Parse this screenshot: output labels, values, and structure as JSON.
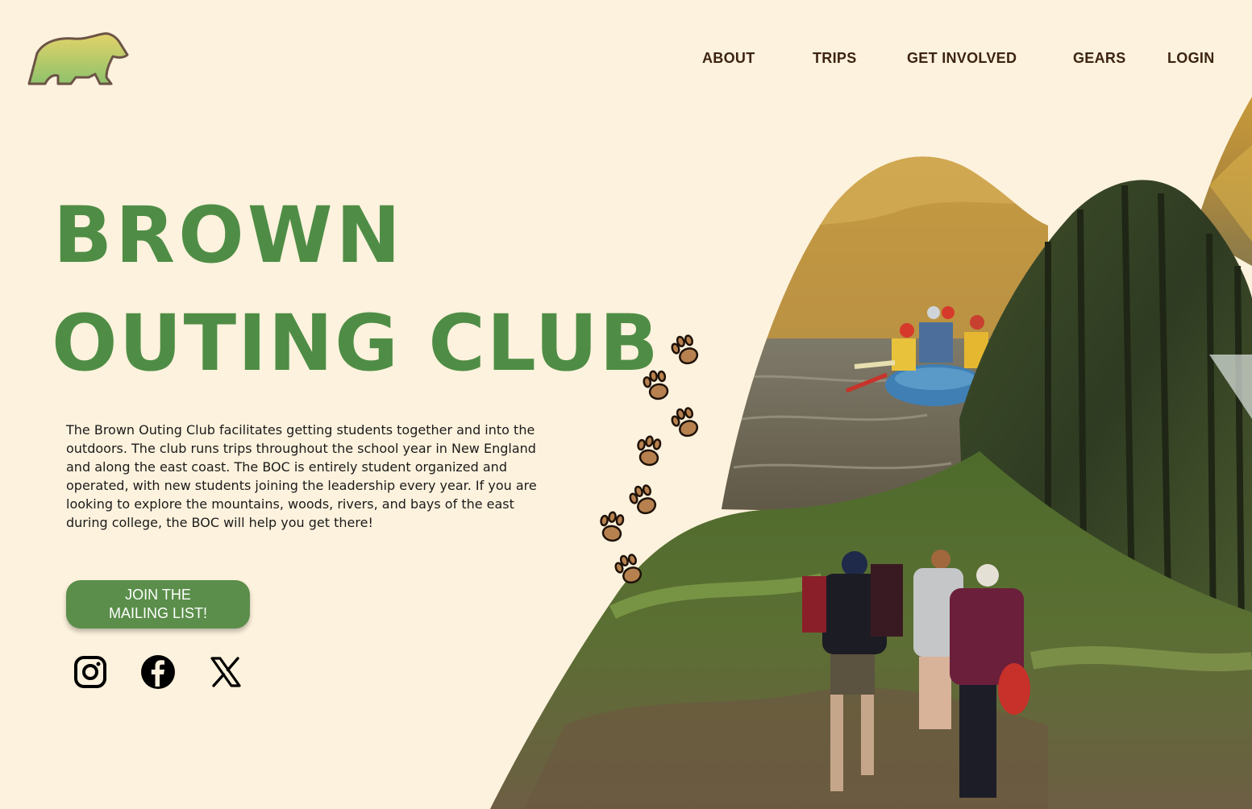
{
  "colors": {
    "background": "#fdf2dd",
    "brand_green": "#4f8d46",
    "button_green": "#5a8e4a",
    "nav_text": "#3d2412",
    "paw_fill": "#b7814f"
  },
  "header": {
    "logo_icon": "bear-logo-icon",
    "nav": [
      {
        "label": "ABOUT"
      },
      {
        "label": "TRIPS"
      },
      {
        "label": "GET INVOLVED"
      },
      {
        "label": "GEARS"
      },
      {
        "label": "LOGIN"
      }
    ]
  },
  "hero": {
    "title_line_1": "BROWN",
    "title_line_2": "OUTING CLUB",
    "intro": "The Brown Outing Club facilitates getting students together and into the outdoors. The club runs trips throughout the school year in New England and along the east coast. The BOC is entirely student organized and operated, with new students joining the leadership every year. If you are looking to explore the mountains, woods, rivers, and bays of the east during college, the BOC will help you get there!",
    "join_button": {
      "line1": "JOIN THE",
      "line2": "MAILING LIST!"
    }
  },
  "social": [
    {
      "icon": "instagram-icon"
    },
    {
      "icon": "facebook-icon"
    },
    {
      "icon": "x-icon"
    }
  ],
  "collage": {
    "photos": [
      "rafting-photo",
      "forest-photo",
      "hiking-photo",
      "autumn-photo"
    ],
    "decoration": "paw-prints-icon"
  }
}
